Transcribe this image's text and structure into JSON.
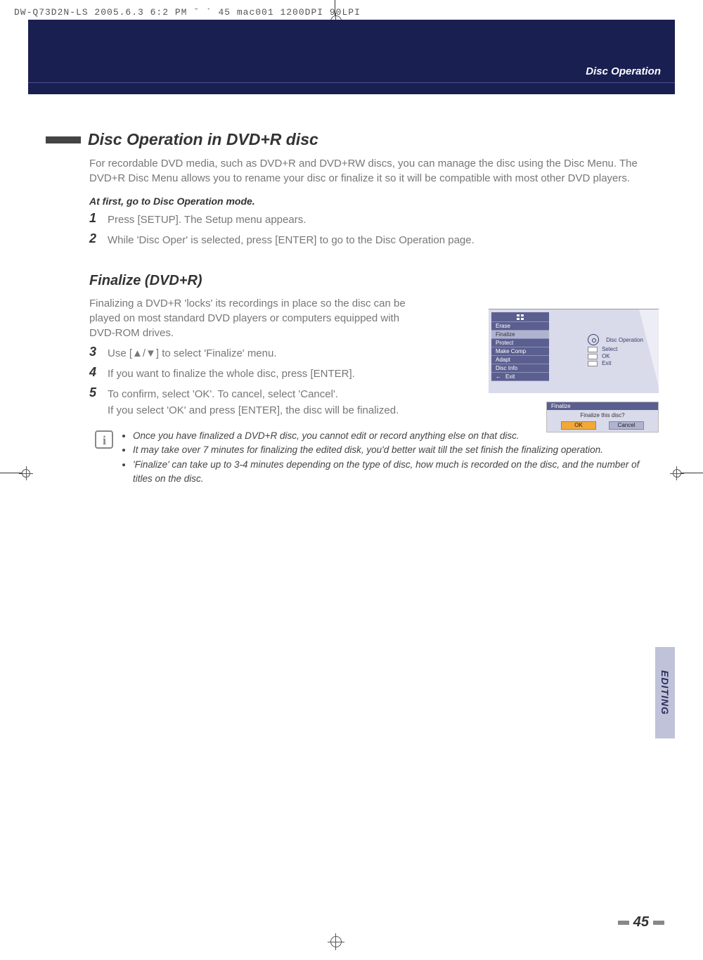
{
  "top_code": "DW-Q73D2N-LS  2005.6.3 6:2 PM  ˘   ` 45   mac001  1200DPI 90LPI",
  "header": {
    "title": "Disc Operation"
  },
  "section": {
    "title": "Disc Operation in DVD+R disc",
    "intro": "For recordable DVD media, such as DVD+R and DVD+RW discs, you can manage the disc using the Disc Menu. The DVD+R Disc Menu allows you to rename your disc or finalize it so it will be compatible with most other DVD players.",
    "at_first": "At first, go to Disc Operation mode.",
    "step1": "Press [SETUP]. The Setup menu appears.",
    "step2": "While 'Disc Oper' is selected, press [ENTER] to go to the Disc Operation page."
  },
  "finalize": {
    "title": "Finalize (DVD+R)",
    "intro": "Finalizing a DVD+R 'locks' its recordings in place so the disc can be played on most standard DVD players or computers equipped with DVD-ROM drives.",
    "step3": "Use [▲/▼] to select 'Finalize' menu.",
    "step4": "If you want to finalize the whole disc, press [ENTER].",
    "step5": "To confirm, select 'OK'. To cancel, select 'Cancel'.",
    "step5b": "If you select 'OK' and press [ENTER], the disc will be finalized."
  },
  "notes": {
    "n1": "Once you have finalized a DVD+R disc, you cannot edit or record anything else on that disc.",
    "n2": "It may take over 7 minutes for finalizing the edited disk, you'd better wait till the set finish the finalizing operation.",
    "n3": "'Finalize' can take up to 3-4 minutes depending on the type of disc, how much is recorded on the disc, and the number of titles on the disc."
  },
  "fig1": {
    "menu": {
      "erase": "Erase",
      "finalize": "Finalize",
      "protect": "Protect",
      "make_comp": "Make Comp",
      "adapt": "Adapt",
      "disc_info": "Disc Info",
      "exit": "Exit"
    },
    "panel": {
      "title": "Disc Operation",
      "select": "Select",
      "ok": "OK",
      "exit": "Exit"
    }
  },
  "fig2": {
    "head": "Finalize",
    "question": "Finalize this disc?",
    "ok": "OK",
    "cancel": "Cancel"
  },
  "tab": "EDITING",
  "page": "45"
}
